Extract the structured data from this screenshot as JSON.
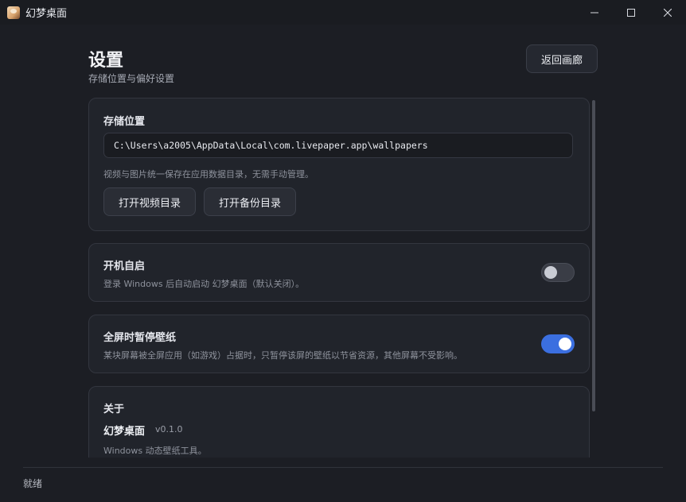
{
  "window": {
    "title": "幻梦桌面",
    "controls": [
      "minimize-icon",
      "maximize-icon",
      "close-icon"
    ]
  },
  "header": {
    "title": "设置",
    "subtitle": "存储位置与偏好设置",
    "back_label": "返回画廊"
  },
  "storage": {
    "title": "存储位置",
    "path": "C:\\Users\\a2005\\AppData\\Local\\com.livepaper.app\\wallpapers",
    "note": "视频与图片统一保存在应用数据目录，无需手动管理。",
    "open_video_label": "打开视频目录",
    "open_backup_label": "打开备份目录"
  },
  "autostart": {
    "title": "开机自启",
    "desc": "登录 Windows 后自动启动 幻梦桌面（默认关闭）。",
    "enabled": false
  },
  "fullscreen_pause": {
    "title": "全屏时暂停壁纸",
    "desc": "某块屏幕被全屏应用（如游戏）占据时，只暂停该屏的壁纸以节省资源，其他屏幕不受影响。",
    "enabled": true
  },
  "about": {
    "title": "关于",
    "app_name": "幻梦桌面",
    "version": "v0.1.0",
    "desc": "Windows 动态壁纸工具。"
  },
  "status_bar": {
    "text": "就绪"
  },
  "colors": {
    "accent": "#3b6fe0",
    "background": "#1c1e24",
    "card": "#21242b"
  }
}
